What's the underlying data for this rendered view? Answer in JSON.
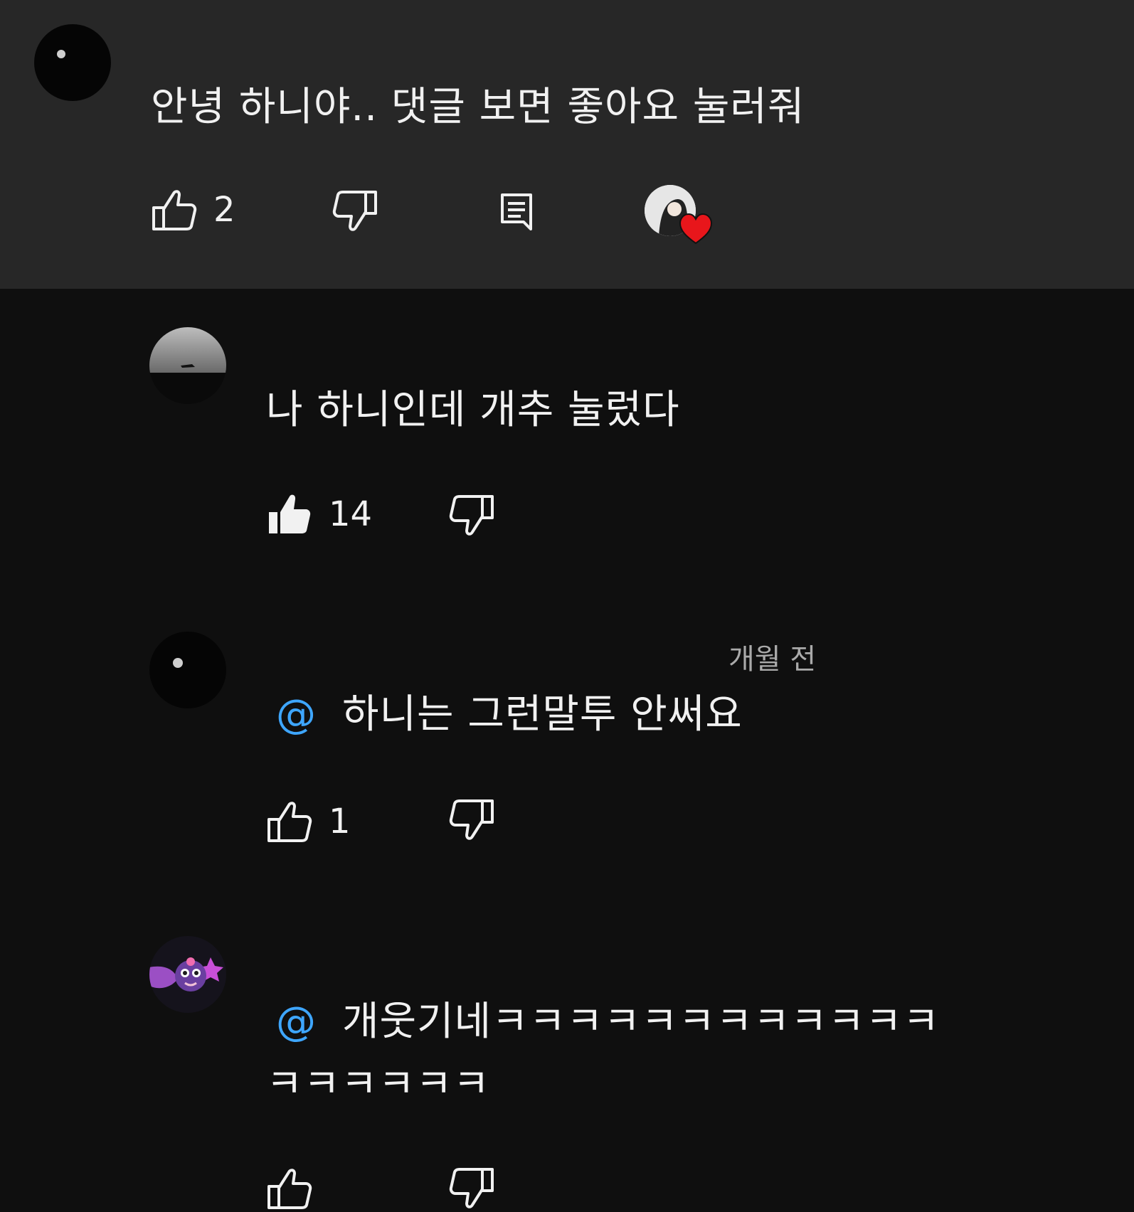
{
  "comments": [
    {
      "handle": "",
      "text": "안녕 하니야.. 댓글 보면 좋아요 눌러줘",
      "likes": "2",
      "has_reply_button": true,
      "creator_heart": true
    },
    {
      "handle": "",
      "text": "나 하니인데 개추 눌렀다",
      "likes": "14",
      "liked": true
    },
    {
      "handle": "",
      "time": "개월 전",
      "mention": "@",
      "text": "하니는 그런말투 안써요",
      "likes": "1"
    },
    {
      "handle": "",
      "mention": "@",
      "text_line1": "개웃기네ㅋㅋㅋㅋㅋㅋㅋㅋㅋㅋㅋㅋ",
      "text_line2": "ㅋㅋㅋㅋㅋㅋ",
      "likes": ""
    }
  ],
  "colors": {
    "background": "#0f0f0f",
    "top_comment_bg": "#272727",
    "text": "#f1f1f1",
    "secondary": "#aaaaaa",
    "mention": "#3ea6ff",
    "heart": "#e8161b"
  },
  "icons": {
    "like": "thumbs-up-icon",
    "like_filled": "thumbs-up-filled-icon",
    "dislike": "thumbs-down-icon",
    "reply": "reply-comment-icon",
    "heart": "creator-heart-icon"
  }
}
